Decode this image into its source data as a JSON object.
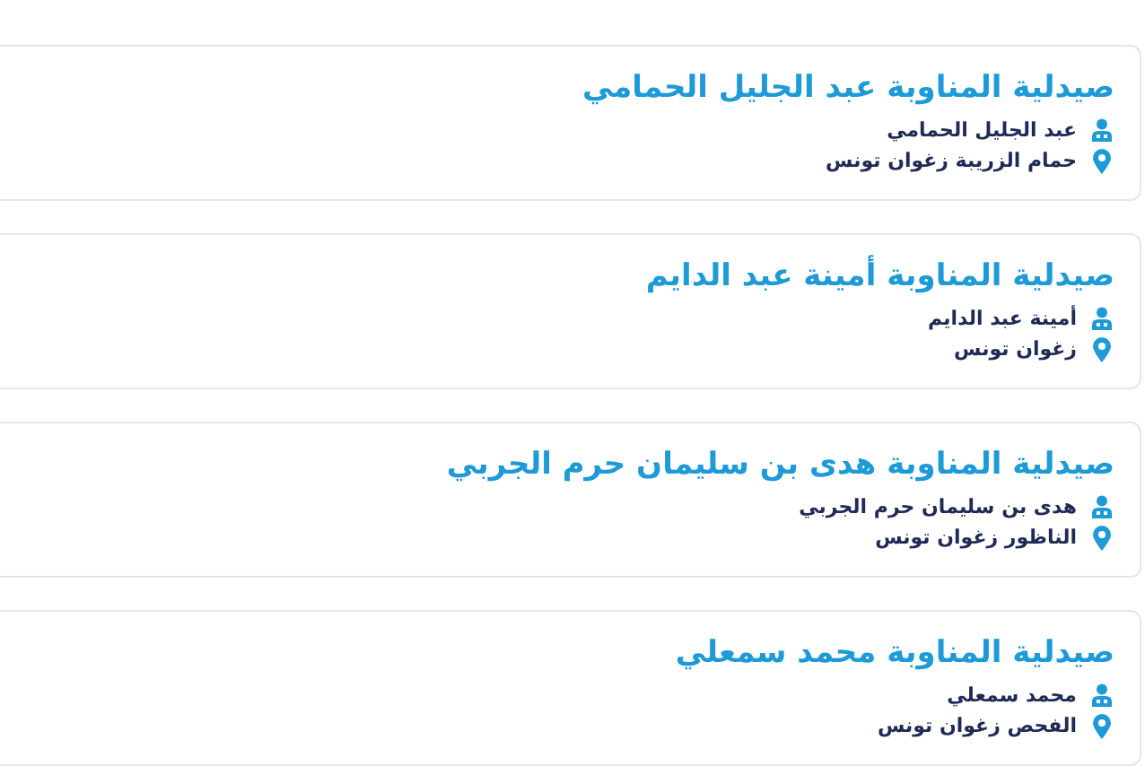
{
  "pharmacies": [
    {
      "title": "صيدلية المناوبة عبد الجليل الحمامي",
      "owner": "عبد الجليل الحمامي",
      "address": "حمام الزريبة زغوان تونس"
    },
    {
      "title": "صيدلية المناوبة أمينة عبد الدايم",
      "owner": "أمينة عبد الدايم",
      "address": "زغوان تونس"
    },
    {
      "title": "صيدلية المناوبة هدى بن سليمان حرم الجربي",
      "owner": "هدى بن سليمان حرم الجربي",
      "address": "الناظور زغوان تونس"
    },
    {
      "title": "صيدلية المناوبة محمد سمعلي",
      "owner": "محمد سمعلي",
      "address": "الفحص زغوان تونس"
    }
  ]
}
